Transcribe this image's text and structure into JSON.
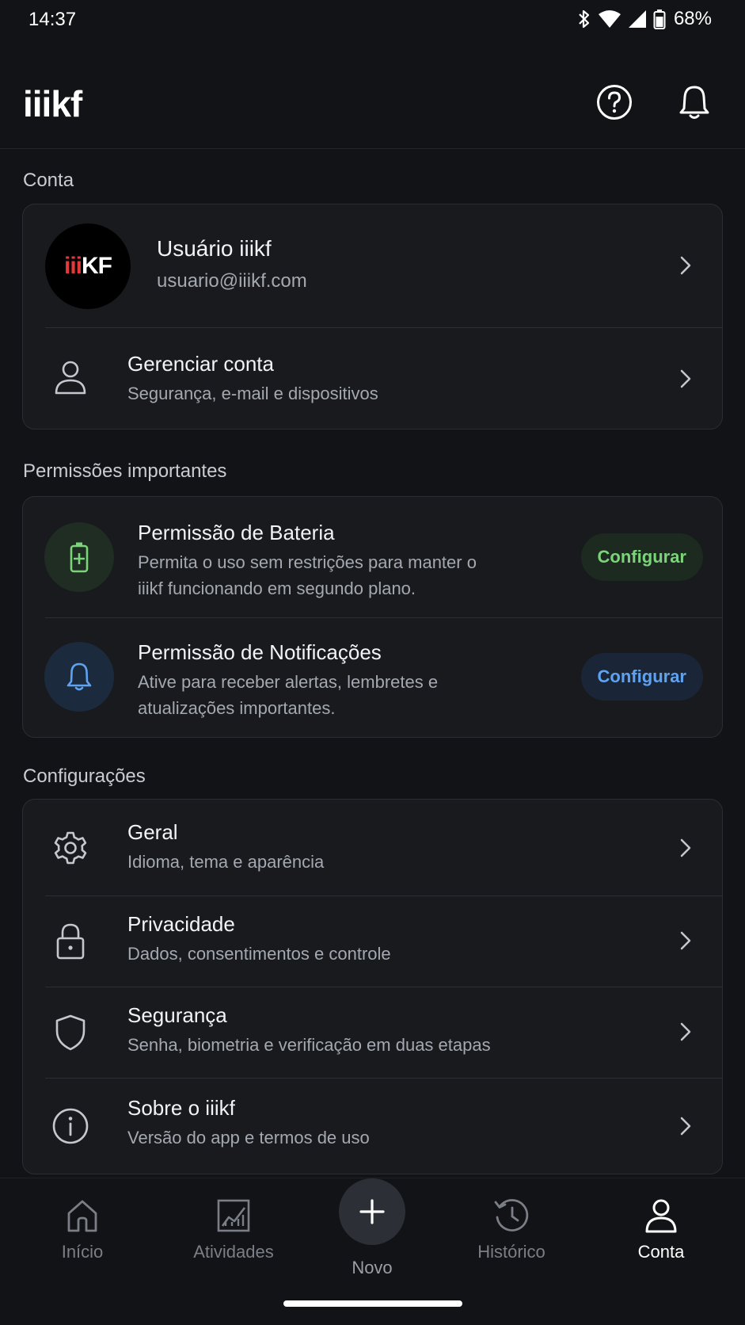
{
  "status_bar": {
    "time": "14:37",
    "battery": "68%"
  },
  "header": {
    "app_name": "iiikf"
  },
  "account": {
    "section_label": "Conta",
    "avatar_text_accent": "iii",
    "avatar_text_rest": "KF",
    "user_name": "Usuário iiikf",
    "email": "usuario@iiikf.com",
    "manage_title": "Gerenciar conta",
    "manage_subtitle": "Segurança, e-mail e dispositivos"
  },
  "permissions": {
    "section_label": "Permissões importantes",
    "items": [
      {
        "title": "Permissão de Bateria",
        "line1": "Permita o uso sem restrições para manter o",
        "line2": "iiikf funcionando em segundo plano.",
        "button": "Configurar",
        "icon": "battery-icon",
        "accent": "#7cd47a"
      },
      {
        "title": "Permissão de Notificações",
        "line1": "Ative para receber alertas, lembretes e",
        "line2": "atualizações importantes.",
        "button": "Configurar",
        "icon": "bell-icon",
        "accent": "#5fa3f0"
      }
    ]
  },
  "settings": {
    "section_label": "Configurações",
    "items": [
      {
        "title": "Geral",
        "subtitle": "Idioma, tema e aparência",
        "icon": "gear-icon"
      },
      {
        "title": "Privacidade",
        "subtitle": "Dados, consentimentos e controle",
        "icon": "lock-icon"
      },
      {
        "title": "Segurança",
        "subtitle": "Senha, biometria e verificação em duas etapas",
        "icon": "shield-icon"
      },
      {
        "title": "Sobre o iiikf",
        "subtitle": "Versão do app e termos de uso",
        "icon": "info-icon"
      }
    ]
  },
  "bottom_nav": {
    "items": [
      {
        "label": "Início",
        "icon": "home-icon"
      },
      {
        "label": "Atividades",
        "icon": "chart-icon"
      },
      {
        "label": "Novo",
        "icon": "plus-icon"
      },
      {
        "label": "Histórico",
        "icon": "history-icon"
      },
      {
        "label": "Conta",
        "icon": "user-icon",
        "active": true
      }
    ]
  }
}
